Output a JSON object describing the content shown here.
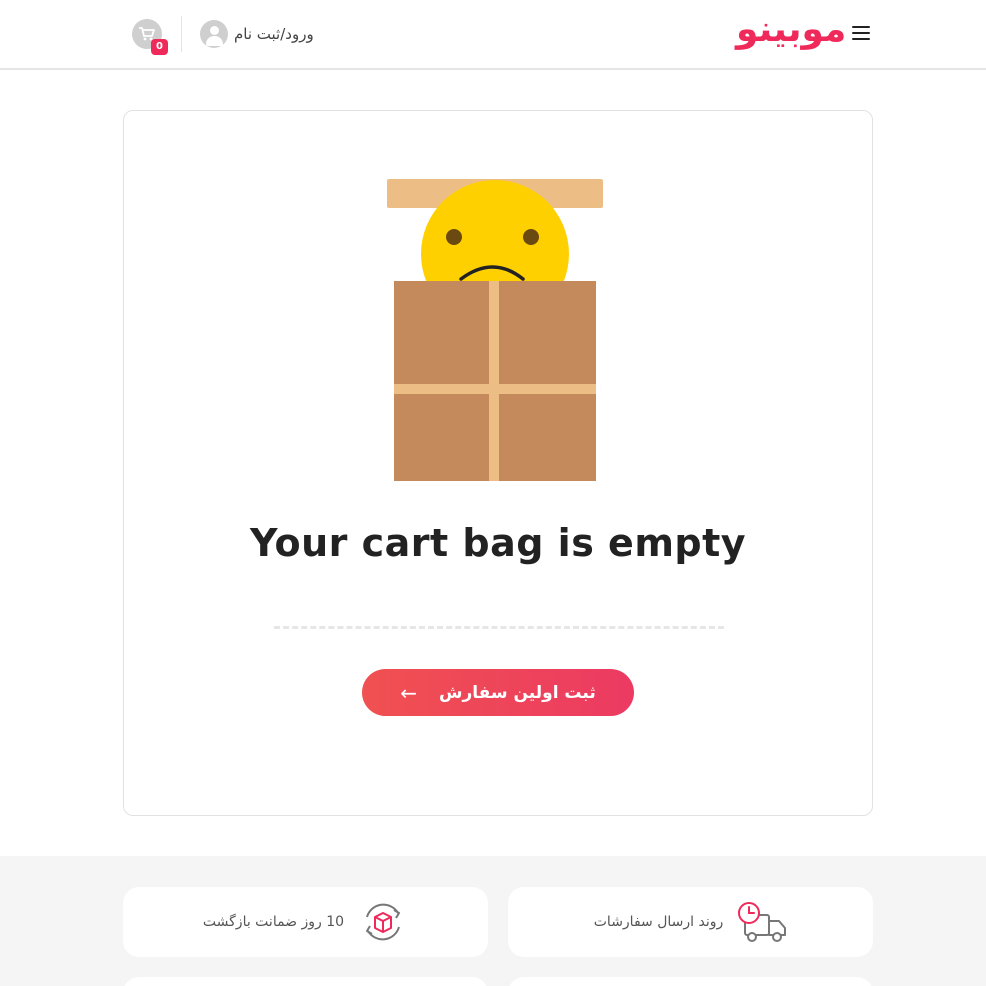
{
  "header": {
    "brand": "موبینو",
    "login_label": "ورود/ثبت نام",
    "cart_count": "0",
    "menu_icon": "hamburger-icon",
    "cart_icon": "cart-icon",
    "user_icon": "user-icon"
  },
  "empty_cart": {
    "title": "Your cart bag is empty",
    "cta_label": "ثبت اولین سفارش",
    "cta_arrow": "←",
    "illustration": "sad-face-in-box"
  },
  "features": [
    {
      "label": "روند ارسال سفارشات",
      "icon": "delivery-truck-icon"
    },
    {
      "label": "10 روز ضمانت بازگشت",
      "icon": "return-box-icon"
    }
  ],
  "colors": {
    "brand": "#ef2a5b",
    "cta_start": "#f05151",
    "cta_end": "#ec3a62"
  }
}
